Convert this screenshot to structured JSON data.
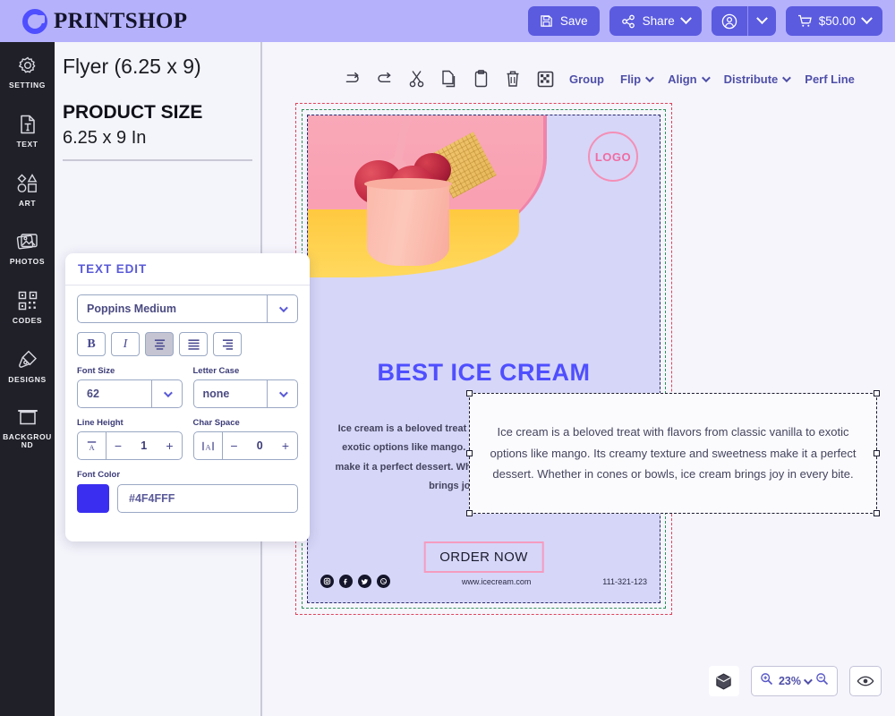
{
  "header": {
    "brand": "PRINTSHOP",
    "brand_icon": "ring-logo-icon",
    "save_label": "Save",
    "share_label": "Share",
    "account_icon": "user-avatar-icon",
    "cart_price": "$50.00"
  },
  "sidebar": {
    "items": [
      {
        "label": "SETTING",
        "icon": "gear-icon"
      },
      {
        "label": "TEXT",
        "icon": "text-document-icon"
      },
      {
        "label": "ART",
        "icon": "shapes-icon"
      },
      {
        "label": "PHOTOS",
        "icon": "photos-icon"
      },
      {
        "label": "CODES",
        "icon": "qr-code-icon"
      },
      {
        "label": "DESIGNS",
        "icon": "designs-icon"
      },
      {
        "label": "BACKGROUND",
        "icon": "background-icon"
      }
    ]
  },
  "left_panel": {
    "title": "Flyer (6.25 x 9)",
    "product_size_label": "PRODUCT SIZE",
    "product_size_value": "6.25 x 9 In"
  },
  "edit_toolbar": {
    "icons": [
      {
        "name": "redo-icon"
      },
      {
        "name": "undo-icon"
      },
      {
        "name": "cut-icon"
      },
      {
        "name": "copy-icon"
      },
      {
        "name": "paste-icon"
      },
      {
        "name": "delete-icon"
      },
      {
        "name": "transparency-icon"
      }
    ],
    "group_label": "Group",
    "flip_label": "Flip",
    "align_label": "Align",
    "distribute_label": "Distribute",
    "perf_line_label": "Perf Line"
  },
  "text_edit": {
    "panel_title": "TEXT EDIT",
    "font_family": "Poppins Medium",
    "bold_label": "B",
    "italic_label": "I",
    "align_left_icon": "align-left-icon",
    "align_center_icon": "align-center-icon",
    "align_right_icon": "align-right-icon",
    "active_align": "align-center",
    "font_size_label": "Font Size",
    "font_size_value": "62",
    "letter_case_label": "Letter Case",
    "letter_case_value": "none",
    "line_height_label": "Line Height",
    "line_height_value": "1",
    "line_height_icon": "line-height-icon",
    "char_space_label": "Char Space",
    "char_space_value": "0",
    "char_space_icon": "char-space-icon",
    "minus_label": "−",
    "plus_label": "+",
    "font_color_label": "Font Color",
    "font_color_hex": "#4F4FFF"
  },
  "flyer": {
    "logo_badge": "LOGO",
    "title": "BEST ICE CREAM",
    "body": "Ice cream is a beloved treat with flavors from classic vanilla to exotic options like mango. Its creamy texture and sweetness make it a perfect dessert. Whether in cones or bowls, ice cream brings joy in every bite.",
    "order_button": "ORDER NOW",
    "website": "www.icecream.com",
    "phone": "111-321-123",
    "socials": [
      "instagram-icon",
      "facebook-icon",
      "twitter-icon",
      "whatsapp-icon"
    ],
    "title_color": "#4F4FFF"
  },
  "floating_text": {
    "content": "Ice cream is a beloved treat with flavors from classic vanilla to exotic options like mango. Its creamy texture and sweetness make it a perfect dessert. Whether in cones or bowls, ice cream brings joy in every bite."
  },
  "zoom_bar": {
    "cube_icon": "3d-cube-icon",
    "zoom_in_icon": "zoom-in-icon",
    "zoom_out_icon": "zoom-out-icon",
    "zoom_level": "23%",
    "preview_icon": "eye-icon"
  }
}
